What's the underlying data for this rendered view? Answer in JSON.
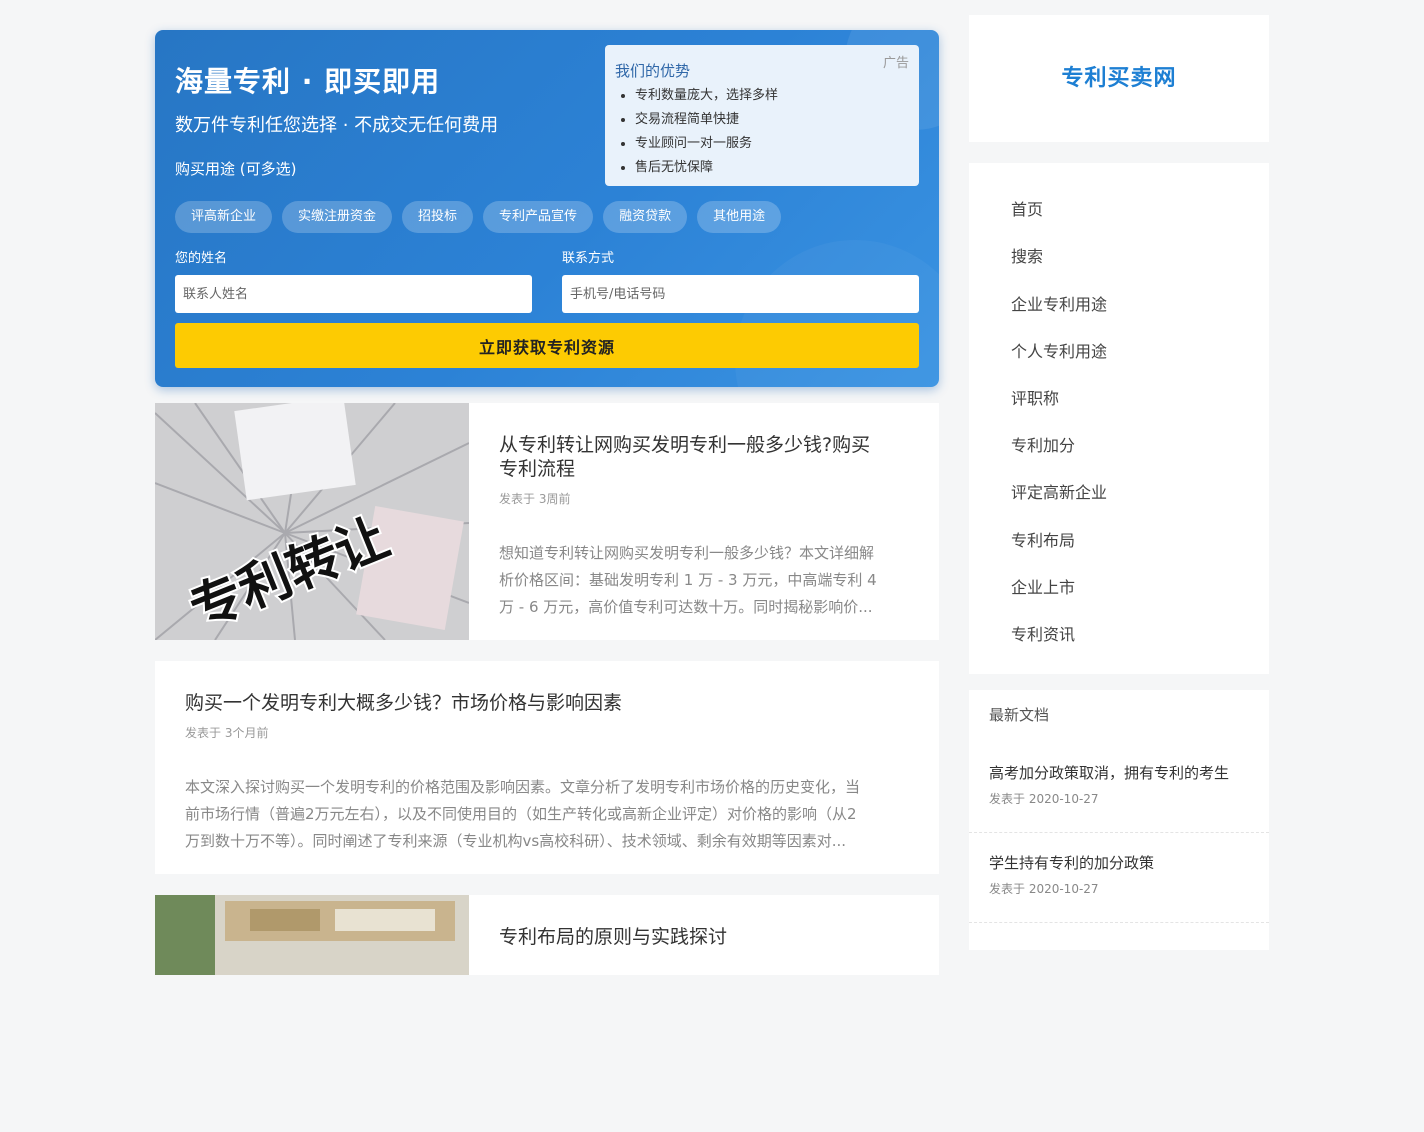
{
  "promo": {
    "title": "海量专利 · 即买即用",
    "subtitle": "数万件专利任您选择 · 不成交无任何费用",
    "usage_label": "购买用途 (可多选)",
    "ad_label": "广告",
    "advantages_title": "我们的优势",
    "advantages": [
      "专利数量庞大，选择多样",
      "交易流程简单快捷",
      "专业顾问一对一服务",
      "售后无忧保障"
    ],
    "tags": [
      "评高新企业",
      "实缴注册资金",
      "招投标",
      "专利产品宣传",
      "融资贷款",
      "其他用途"
    ],
    "name_label": "您的姓名",
    "name_placeholder": "联系人姓名",
    "contact_label": "联系方式",
    "contact_placeholder": "手机号/电话号码",
    "submit_label": "立即获取专利资源"
  },
  "articles": [
    {
      "thumb_text": "专利转让",
      "title_line1": "从专利转让网购买发明专利一般多少钱?购买",
      "title_line2": "专利流程",
      "meta": "发表于 3周前",
      "excerpt_line1": "想知道专利转让网购买发明专利一般多少钱？本文详细解",
      "excerpt_line2": "析价格区间：基础发明专利 1 万 - 3 万元，中高端专利 4",
      "excerpt_line3": "万 - 6 万元，高价值专利可达数十万。同时揭秘影响价..."
    },
    {
      "title": "购买一个发明专利大概多少钱？市场价格与影响因素",
      "meta": "发表于 3个月前",
      "excerpt_line1": "本文深入探讨购买一个发明专利的价格范围及影响因素。文章分析了发明专利市场价格的历史变化，当",
      "excerpt_line2": "前市场行情（普遍2万元左右），以及不同使用目的（如生产转化或高新企业评定）对价格的影响（从2",
      "excerpt_line3": "万到数十万不等）。同时阐述了专利来源（专业机构vs高校科研）、技术领域、剩余有效期等因素对..."
    },
    {
      "title": "专利布局的原则与实践探讨"
    }
  ],
  "sidebar": {
    "logo": "专利买卖网",
    "nav": [
      "首页",
      "搜索",
      "企业专利用途",
      "个人专利用途",
      "评职称",
      "专利加分",
      "评定高新企业",
      "专利布局",
      "企业上市",
      "专利资讯"
    ],
    "docs_title": "最新文档",
    "docs": [
      {
        "title": "高考加分政策取消，拥有专利的考生",
        "date": "发表于 2020-10-27"
      },
      {
        "title": "学生持有专利的加分政策",
        "date": "发表于 2020-10-27"
      }
    ]
  },
  "colors": {
    "banner": "#2c82d6",
    "submit": "#fdcb02",
    "logo": "#1d7fd3"
  }
}
